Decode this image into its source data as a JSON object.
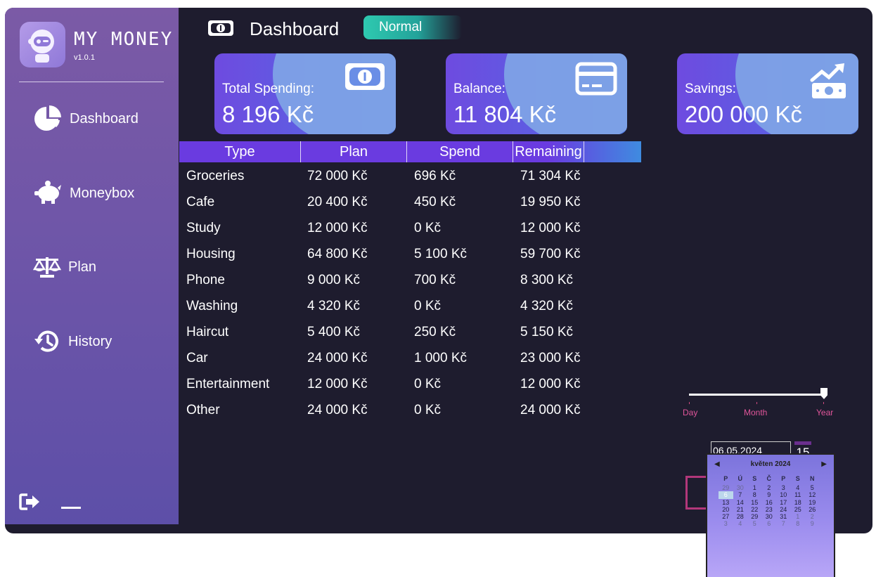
{
  "app": {
    "title": "MY MONEY",
    "version": "v1.0.1"
  },
  "nav": {
    "items": [
      {
        "label": "Dashboard",
        "icon": "pie-chart-icon"
      },
      {
        "label": "Moneybox",
        "icon": "piggy-bank-icon"
      },
      {
        "label": "Plan",
        "icon": "scale-icon"
      },
      {
        "label": "History",
        "icon": "history-icon"
      }
    ],
    "logout_icon": "logout-icon",
    "minimize_icon": "minimize-icon"
  },
  "header": {
    "title": "Dashboard",
    "mode": "Normal"
  },
  "cards": [
    {
      "label": "Total Spending:",
      "value": "8 196 Kč",
      "icon": "banknote-icon"
    },
    {
      "label": "Balance:",
      "value": "11 804 Kč",
      "icon": "credit-card-icon"
    },
    {
      "label": "Savings:",
      "value": "200 000 Kč",
      "icon": "savings-growth-icon"
    }
  ],
  "table": {
    "columns": [
      "Type",
      "Plan",
      "Spend",
      "Remaining"
    ],
    "rows": [
      [
        "Groceries",
        "72 000 Kč",
        "696 Kč",
        "71 304 Kč"
      ],
      [
        "Cafe",
        "20 400 Kč",
        "450 Kč",
        "19 950 Kč"
      ],
      [
        "Study",
        "12 000 Kč",
        "0 Kč",
        "12 000 Kč"
      ],
      [
        "Housing",
        "64 800 Kč",
        "5 100 Kč",
        "59 700 Kč"
      ],
      [
        "Phone",
        "9 000 Kč",
        "700 Kč",
        "8 300 Kč"
      ],
      [
        "Washing",
        "4 320 Kč",
        "0 Kč",
        "4 320 Kč"
      ],
      [
        "Haircut",
        "5 400 Kč",
        "250 Kč",
        "5 150 Kč"
      ],
      [
        "Car",
        "24 000 Kč",
        "1 000 Kč",
        "23 000 Kč"
      ],
      [
        "Entertainment",
        "12 000 Kč",
        "0 Kč",
        "12 000 Kč"
      ],
      [
        "Other",
        "24 000 Kč",
        "0 Kč",
        "24 000 Kč"
      ]
    ]
  },
  "period_slider": {
    "labels": [
      "Day",
      "Month",
      "Year"
    ],
    "selected": "Year"
  },
  "date_picker": {
    "value": "06.05.2024",
    "button_label": "15",
    "month_title": "květen 2024",
    "weekdays": [
      "P",
      "Ú",
      "S",
      "Č",
      "P",
      "S",
      "N"
    ],
    "days": [
      [
        "29",
        "30",
        "1",
        "2",
        "3",
        "4",
        "5"
      ],
      [
        "6",
        "7",
        "8",
        "9",
        "10",
        "11",
        "12"
      ],
      [
        "13",
        "14",
        "15",
        "16",
        "17",
        "18",
        "19"
      ],
      [
        "20",
        "21",
        "22",
        "23",
        "24",
        "25",
        "26"
      ],
      [
        "27",
        "28",
        "29",
        "30",
        "31",
        "1",
        "2"
      ],
      [
        "3",
        "4",
        "5",
        "6",
        "7",
        "8",
        "9"
      ]
    ],
    "selected_day": "6"
  },
  "colors": {
    "background": "#1e1c2e",
    "accent_purple": "#6a3be0",
    "accent_teal": "#2ec9b0",
    "accent_pink": "#e0559a"
  }
}
